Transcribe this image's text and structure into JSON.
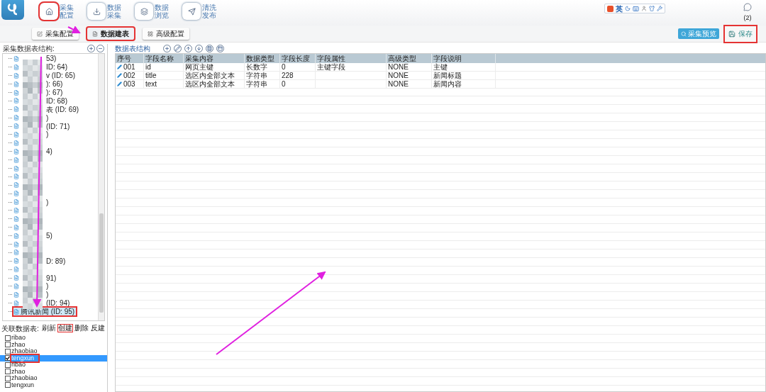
{
  "nav": [
    {
      "label": "采集配置",
      "highlighted": true
    },
    {
      "label": "数据采集",
      "highlighted": false
    },
    {
      "label": "数据浏览",
      "highlighted": false
    },
    {
      "label": "清洗发布",
      "highlighted": false
    }
  ],
  "ime": {
    "label": "英"
  },
  "counter": "(2)",
  "subtabs": [
    {
      "label": "采集配置",
      "selected": false,
      "highlighted": false
    },
    {
      "label": "数据建表",
      "selected": true,
      "highlighted": true
    },
    {
      "label": "高级配置",
      "selected": false,
      "highlighted": false
    }
  ],
  "preview_button": "采集预览",
  "save_button": {
    "label": "保存",
    "highlighted": true
  },
  "left": {
    "title": "采集数据表结构:",
    "tree": [
      {
        "kind": "named",
        "label": "53)"
      },
      {
        "kind": "named",
        "label": "ID: 64)"
      },
      {
        "kind": "named",
        "label": "v (ID: 65)"
      },
      {
        "kind": "named",
        "label": "): 66)"
      },
      {
        "kind": "named",
        "label": "): 67)"
      },
      {
        "kind": "named",
        "label": "ID: 68)"
      },
      {
        "kind": "named",
        "label": "表 (ID: 69)"
      },
      {
        "kind": "named",
        "label": ")"
      },
      {
        "kind": "named",
        "label": "(ID: 71)"
      },
      {
        "kind": "named",
        "label": ")"
      },
      {
        "kind": "masked"
      },
      {
        "kind": "named",
        "label": "4)"
      },
      {
        "kind": "masked"
      },
      {
        "kind": "masked"
      },
      {
        "kind": "masked"
      },
      {
        "kind": "masked"
      },
      {
        "kind": "masked"
      },
      {
        "kind": "named",
        "label": ")"
      },
      {
        "kind": "masked"
      },
      {
        "kind": "masked"
      },
      {
        "kind": "masked"
      },
      {
        "kind": "named",
        "label": "5)"
      },
      {
        "kind": "masked"
      },
      {
        "kind": "masked"
      },
      {
        "kind": "named",
        "label": "D: 89)"
      },
      {
        "kind": "masked"
      },
      {
        "kind": "named",
        "label": "91)"
      },
      {
        "kind": "named",
        "label": ")"
      },
      {
        "kind": "named",
        "label": ")"
      },
      {
        "kind": "named",
        "label": "(ID: 94)"
      },
      {
        "kind": "named",
        "label": "腾讯新闻 (ID: 95)",
        "selected": true,
        "highlighted": true
      }
    ],
    "relation_title": "关联数据表:",
    "relation_actions": [
      {
        "label": "刷新",
        "highlighted": false
      },
      {
        "label": "创建",
        "highlighted": true
      },
      {
        "label": "删除",
        "highlighted": false
      },
      {
        "label": "反建",
        "highlighted": false
      }
    ],
    "relation_tables": [
      {
        "label": "ribao",
        "checked": false,
        "selected": false,
        "highlighted": false
      },
      {
        "label": "zhao",
        "checked": false,
        "selected": false,
        "highlighted": false
      },
      {
        "label": "zhaobiao",
        "checked": false,
        "selected": false,
        "highlighted": false
      },
      {
        "label": "tengxun",
        "checked": true,
        "selected": true,
        "highlighted": true
      },
      {
        "label": "ribao",
        "checked": false,
        "selected": false,
        "highlighted": false
      },
      {
        "label": "zhao",
        "checked": false,
        "selected": false,
        "highlighted": false
      },
      {
        "label": "zhaobiao",
        "checked": false,
        "selected": false,
        "highlighted": false
      },
      {
        "label": "tengxun",
        "checked": false,
        "selected": false,
        "highlighted": false
      }
    ]
  },
  "table": {
    "title": "数据表结构",
    "columns": [
      "序号",
      "字段名称",
      "采集内容",
      "数据类型",
      "字段长度",
      "字段属性",
      "高级类型",
      "字段说明"
    ],
    "rows": [
      [
        "001",
        "id",
        "网页主键",
        "长数字",
        "0",
        "主键字段",
        "NONE",
        "主键"
      ],
      [
        "002",
        "title",
        "选区内全部文本",
        "字符串",
        "228",
        "",
        "NONE",
        "新闻标题"
      ],
      [
        "003",
        "text",
        "选区内全部文本",
        "字符串",
        "0",
        "",
        "NONE",
        "新闻内容"
      ]
    ]
  }
}
